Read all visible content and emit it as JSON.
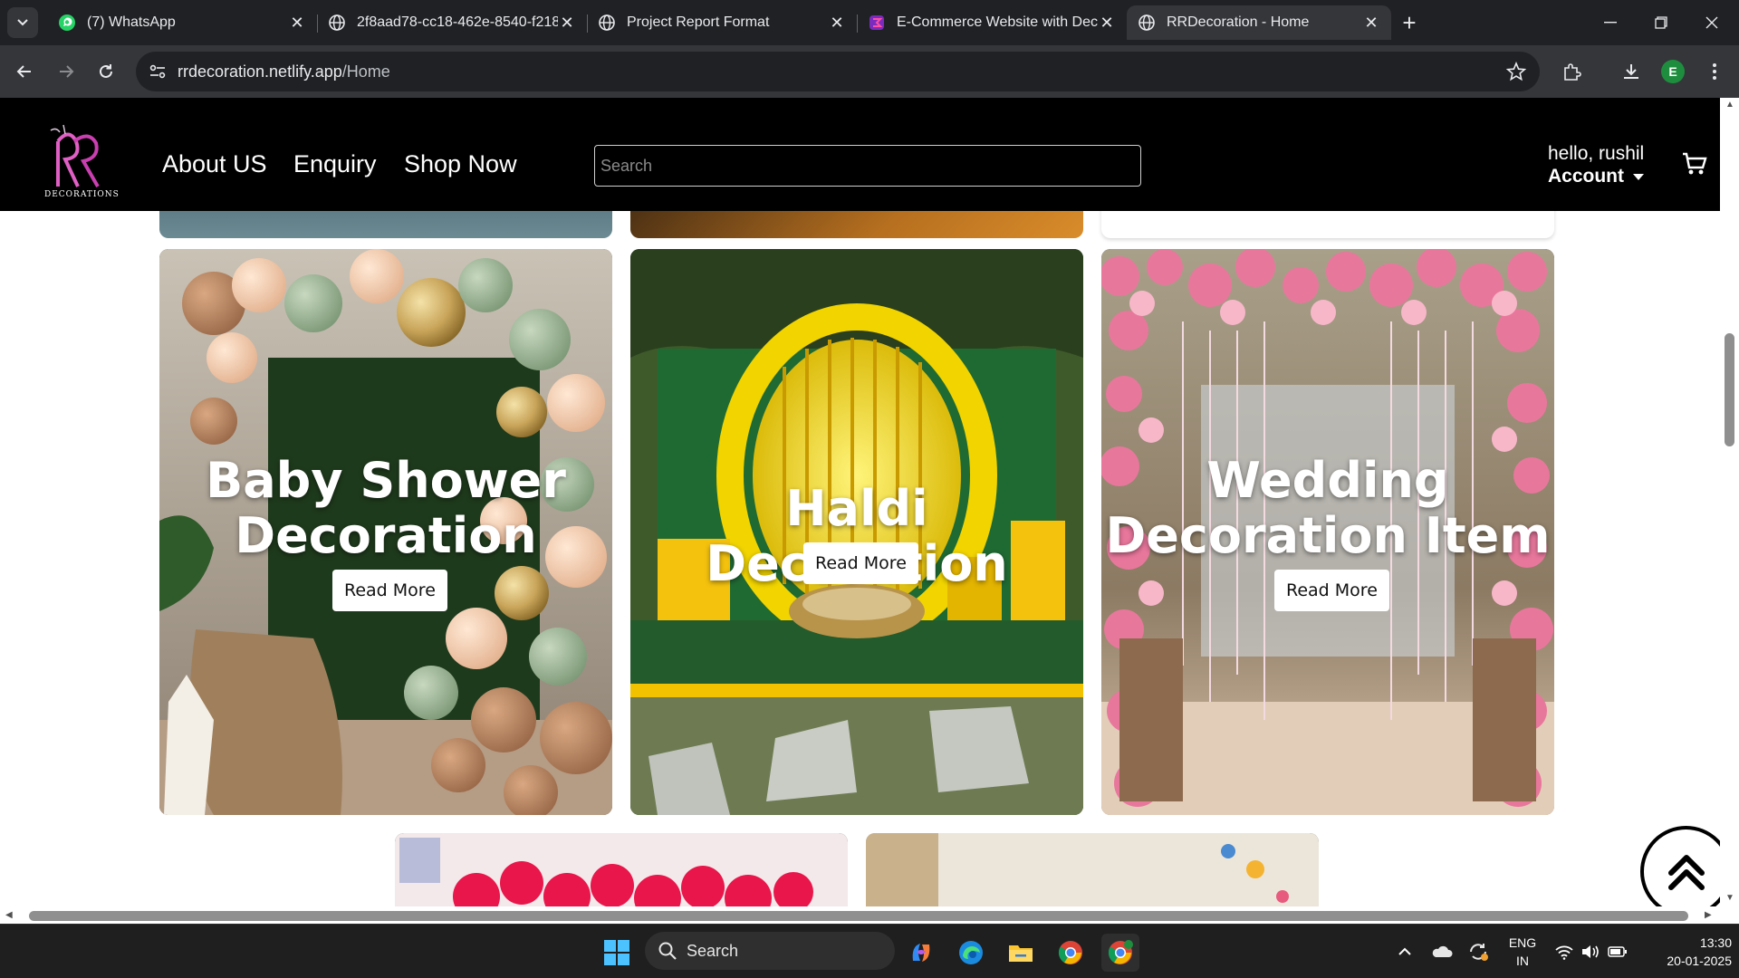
{
  "browser": {
    "tabs": [
      {
        "title": "(7) WhatsApp",
        "favicon": "whatsapp-icon",
        "active": false
      },
      {
        "title": "2f8aad78-cc18-462e-8540-f218",
        "favicon": "globe-icon",
        "active": false
      },
      {
        "title": "Project Report Format",
        "favicon": "globe-icon",
        "active": false
      },
      {
        "title": "E-Commerce Website with Deco",
        "favicon": "app-icon",
        "active": false
      },
      {
        "title": "RRDecoration - Home",
        "favicon": "globe-icon",
        "active": true
      }
    ],
    "url_host": "rrdecoration.netlify.app",
    "url_path": "/Home",
    "profile_initial": "E"
  },
  "site": {
    "logo_text": "DECORATIONS",
    "nav": [
      "About US",
      "Enquiry",
      "Shop Now"
    ],
    "search_placeholder": "Search",
    "greeting": "hello, rushil",
    "account_label": "Account"
  },
  "cards": [
    {
      "title_line1": "Baby Shower",
      "title_line2": "Decoration",
      "button": "Read More"
    },
    {
      "title_line1": "Haldi Decoration",
      "title_line2": "",
      "button": "Read More"
    },
    {
      "title_line1": "Wedding",
      "title_line2": "Decoration Item",
      "button": "Read More"
    }
  ],
  "taskbar": {
    "search_label": "Search",
    "lang_line1": "ENG",
    "lang_line2": "IN",
    "time": "13:30",
    "date": "20-01-2025"
  },
  "colors": {
    "header_bg": "#000000",
    "browser_dark": "#202124",
    "toolbar": "#35363a"
  }
}
